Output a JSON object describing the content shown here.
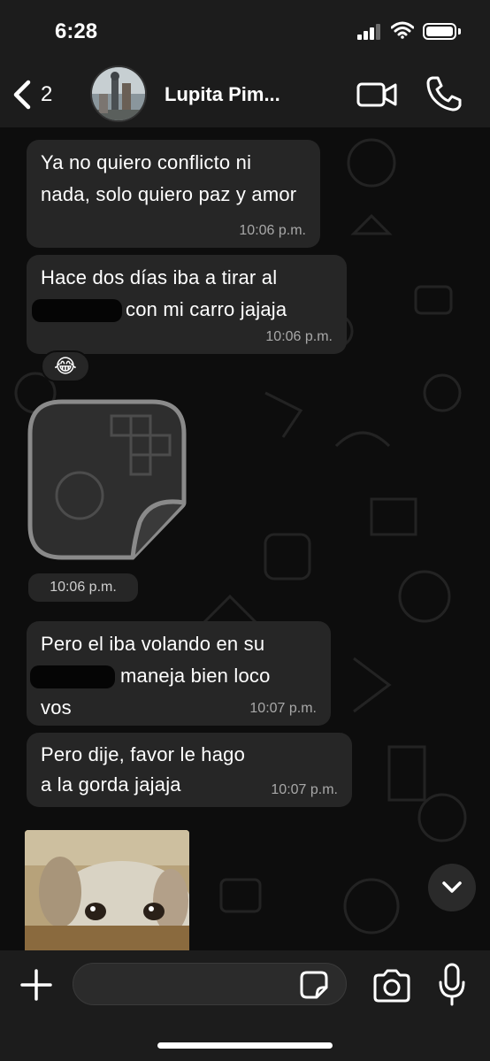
{
  "status_bar": {
    "time": "6:28",
    "icons": [
      "cellular-signal-icon",
      "wifi-icon",
      "battery-icon"
    ]
  },
  "header": {
    "back_count": "2",
    "contact_name": "Lupita Pim...",
    "icons": [
      "chevron-left-icon",
      "video-camera-icon",
      "phone-icon"
    ]
  },
  "messages": [
    {
      "type": "text",
      "text": "Ya no quiero conflicto ni nada, solo quiero paz y amor",
      "time": "10:06 p.m."
    },
    {
      "type": "text",
      "line1": "Hace dos días iba a tirar al",
      "line2": "con mi carro jajaja",
      "time": "10:06 p.m.",
      "reaction": "😂"
    },
    {
      "type": "sticker",
      "time": "10:06 p.m."
    },
    {
      "type": "text",
      "line1": "Pero el iba volando en su",
      "line2": "maneja bien loco",
      "line3": "vos",
      "time": "10:07 p.m."
    },
    {
      "type": "text",
      "text": "Pero dije, favor le hago a la gorda jajaja",
      "time": "10:07 p.m."
    },
    {
      "type": "photo"
    }
  ],
  "input_bar": {
    "placeholder": "",
    "icons": [
      "plus-icon",
      "sticker-icon",
      "camera-icon",
      "microphone-icon"
    ]
  },
  "colors": {
    "bubble": "#262626",
    "background": "#0d0d0d",
    "bars": "#1c1c1c",
    "timestamp": "#a8a8a8"
  }
}
